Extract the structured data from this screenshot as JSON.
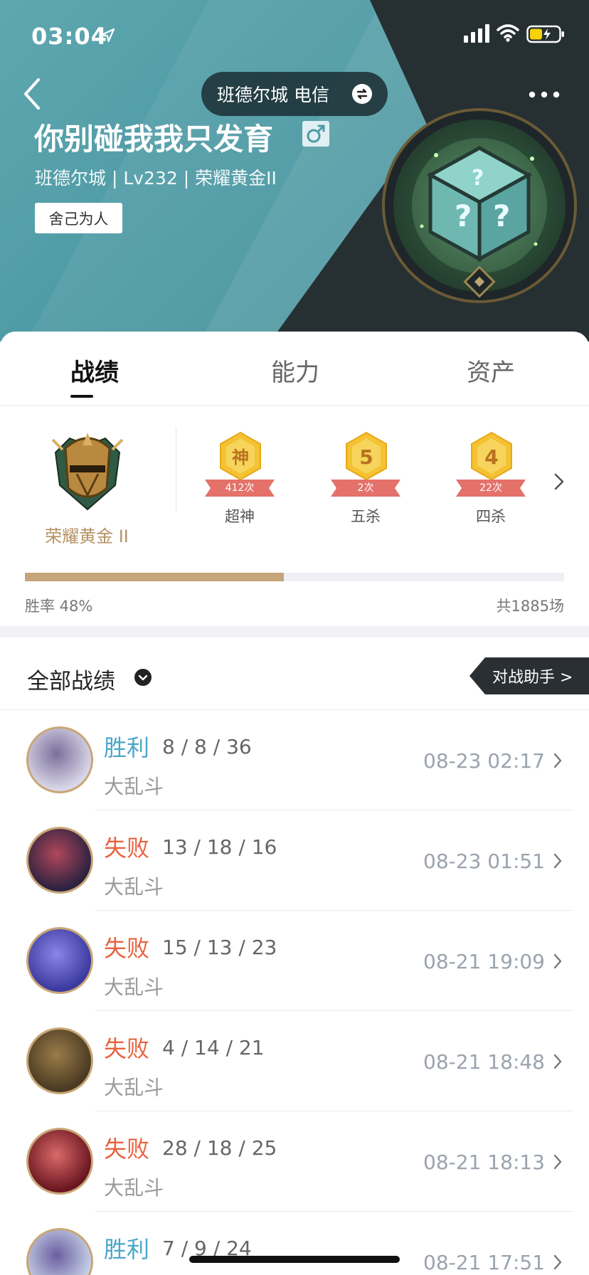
{
  "status_bar": {
    "time": "03:04"
  },
  "header": {
    "server": "班德尔城 电信",
    "nickname": "你别碰我我只发育",
    "subinfo": "班德尔城 | Lv232 | 荣耀黄金II",
    "tag": "舍己为人"
  },
  "tabs": [
    {
      "label": "战绩",
      "active": true
    },
    {
      "label": "能力",
      "active": false
    },
    {
      "label": "资产",
      "active": false
    }
  ],
  "rank": {
    "name": "荣耀黄金 II"
  },
  "achievements": [
    {
      "glyph": "神",
      "count": "412次",
      "label": "超神"
    },
    {
      "glyph": "5",
      "count": "2次",
      "label": "五杀"
    },
    {
      "glyph": "4",
      "count": "22次",
      "label": "四杀"
    }
  ],
  "stats": {
    "winrate_text": "胜率 48%",
    "winrate_value": 0.48,
    "total_text": "共1885场"
  },
  "section": {
    "title": "全部战绩",
    "assistant": "对战助手 >"
  },
  "matches": [
    {
      "result": "胜利",
      "kda": "8 / 8 / 36",
      "mode": "大乱斗",
      "time": "08-23 02:17",
      "win": true
    },
    {
      "result": "失败",
      "kda": "13 / 18 / 16",
      "mode": "大乱斗",
      "time": "08-23 01:51",
      "win": false
    },
    {
      "result": "失败",
      "kda": "15 / 13 / 23",
      "mode": "大乱斗",
      "time": "08-21 19:09",
      "win": false
    },
    {
      "result": "失败",
      "kda": "4 / 14 / 21",
      "mode": "大乱斗",
      "time": "08-21 18:48",
      "win": false
    },
    {
      "result": "失败",
      "kda": "28 / 18 / 25",
      "mode": "大乱斗",
      "time": "08-21 18:13",
      "win": false
    },
    {
      "result": "胜利",
      "kda": "7 / 9 / 24",
      "mode": "大乱斗",
      "time": "08-21 17:51",
      "win": true
    }
  ],
  "colors": {
    "win": "#4ba6c9",
    "lose": "#e9623f",
    "gold": "#c6a57a",
    "header_teal": "#4d9aa4",
    "header_dark": "#263033"
  },
  "icons": [
    "location-arrow-icon",
    "signal-icon",
    "wifi-icon",
    "battery-icon",
    "back-arrow-icon",
    "swap-icon",
    "more-icon",
    "male-icon",
    "caret-down-icon",
    "chevron-right-icon"
  ]
}
